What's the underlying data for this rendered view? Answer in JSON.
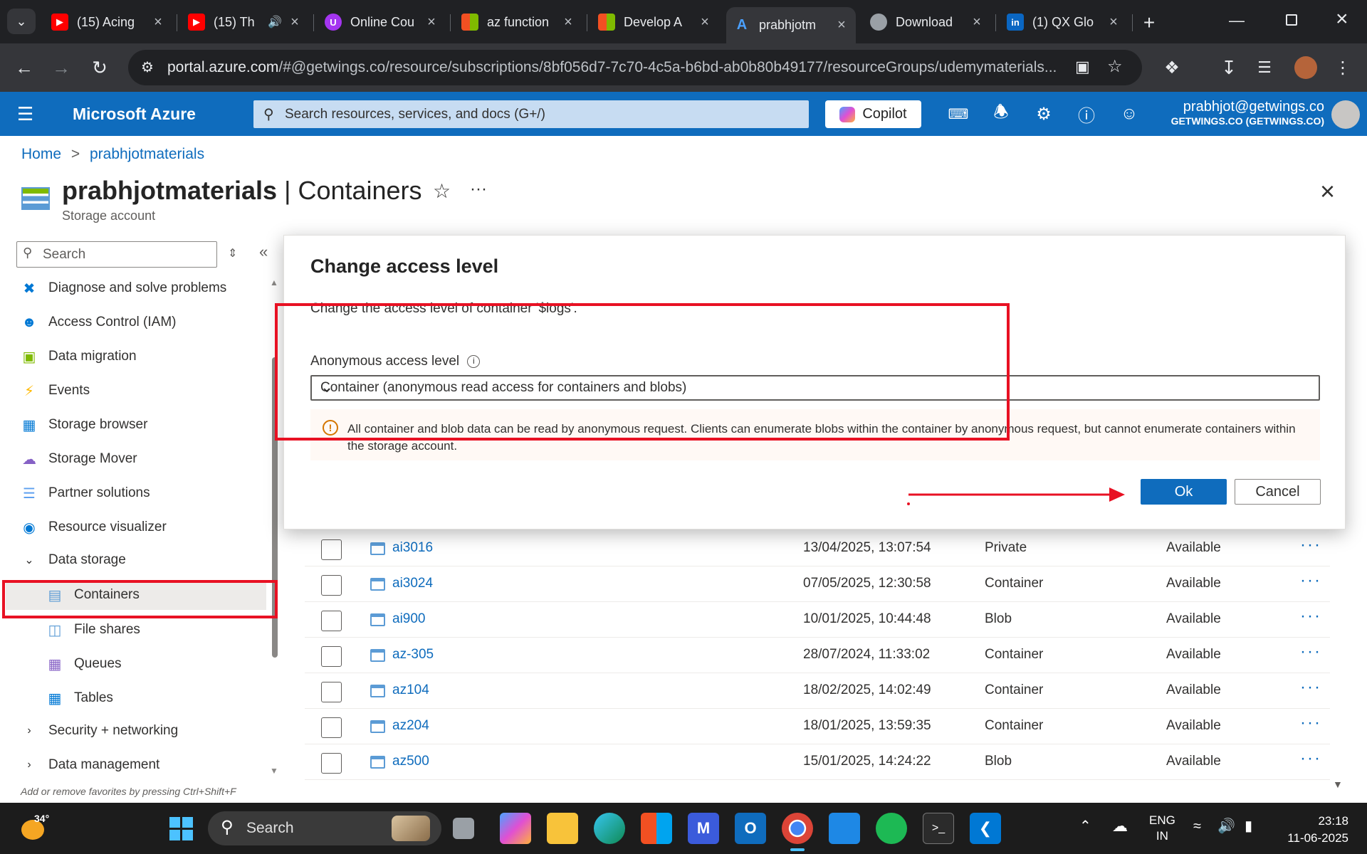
{
  "browser": {
    "tabs": [
      {
        "title": "(15) Acing",
        "favicon": "youtube-icon",
        "color": "#ff0000"
      },
      {
        "title": "(15) Th",
        "favicon": "youtube-icon",
        "color": "#ff0000"
      },
      {
        "title": "Online Cou",
        "favicon": "udemy-icon",
        "color": "#a435f0"
      },
      {
        "title": "az function",
        "favicon": "microsoft-icon",
        "color": "#f25022"
      },
      {
        "title": "Develop A",
        "favicon": "microsoft-icon",
        "color": "#f25022"
      },
      {
        "title": "prabhjotm",
        "favicon": "azure-icon",
        "color": "#0078d4"
      },
      {
        "title": "Download",
        "favicon": "globe-icon",
        "color": "#9aa0a6"
      },
      {
        "title": "(1) QX Glo",
        "favicon": "linkedin-icon",
        "color": "#0a66c2"
      }
    ],
    "url_domain": "portal.azure.com",
    "url_rest": "/#@getwings.co/resource/subscriptions/8bf056d7-7c70-4c5a-b6bd-ab0b80b49177/resourceGroups/udemymaterials..."
  },
  "azure": {
    "title": "Microsoft Azure",
    "search_placeholder": "Search resources, services, and docs (G+/)",
    "copilot": "Copilot",
    "account_email": "prabhjot@getwings.co",
    "account_tenant": "GETWINGS.CO (GETWINGS.CO)"
  },
  "breadcrumb": {
    "home": "Home",
    "sep": ">",
    "current": "prabhjotmaterials"
  },
  "page": {
    "resource": "prabhjotmaterials",
    "sep": " | ",
    "blade": "Containers",
    "subtitle": "Storage account"
  },
  "sidebar": {
    "search_placeholder": "Search",
    "items": [
      {
        "label": "Diagnose and solve problems",
        "icon": "wrench-icon"
      },
      {
        "label": "Access Control (IAM)",
        "icon": "people-icon"
      },
      {
        "label": "Data migration",
        "icon": "migration-icon"
      },
      {
        "label": "Events",
        "icon": "lightning-icon"
      },
      {
        "label": "Storage browser",
        "icon": "storage-browser-icon"
      },
      {
        "label": "Storage Mover",
        "icon": "cloud-mover-icon"
      },
      {
        "label": "Partner solutions",
        "icon": "partner-icon"
      },
      {
        "label": "Resource visualizer",
        "icon": "visualizer-icon"
      },
      {
        "label": "Data storage",
        "icon": "chevron-down-icon"
      },
      {
        "label": "Containers",
        "icon": "container-icon"
      },
      {
        "label": "File shares",
        "icon": "file-share-icon"
      },
      {
        "label": "Queues",
        "icon": "queue-icon"
      },
      {
        "label": "Tables",
        "icon": "table-icon"
      },
      {
        "label": "Security + networking",
        "icon": "chevron-right-icon"
      },
      {
        "label": "Data management",
        "icon": "chevron-right-icon"
      }
    ],
    "favorites_hint": "Add or remove favorites by pressing Ctrl+Shift+F"
  },
  "table": {
    "rows": [
      {
        "name": "ai3016",
        "modified": "13/04/2025, 13:07:54",
        "level": "Private",
        "lease": "Available"
      },
      {
        "name": "ai3024",
        "modified": "07/05/2025, 12:30:58",
        "level": "Container",
        "lease": "Available"
      },
      {
        "name": "ai900",
        "modified": "10/01/2025, 10:44:48",
        "level": "Blob",
        "lease": "Available"
      },
      {
        "name": "az-305",
        "modified": "28/07/2024, 11:33:02",
        "level": "Container",
        "lease": "Available"
      },
      {
        "name": "az104",
        "modified": "18/02/2025, 14:02:49",
        "level": "Container",
        "lease": "Available"
      },
      {
        "name": "az204",
        "modified": "18/01/2025, 13:59:35",
        "level": "Container",
        "lease": "Available"
      },
      {
        "name": "az500",
        "modified": "15/01/2025, 14:24:22",
        "level": "Blob",
        "lease": "Available"
      }
    ],
    "more": "···"
  },
  "dialog": {
    "title": "Change access level",
    "description": "Change the access level of container '$logs'.",
    "field_label": "Anonymous access level",
    "selected": "Container (anonymous read access for containers and blobs)",
    "warning": "All container and blob data can be read by anonymous request. Clients can enumerate blobs within the container by anonymous request, but cannot enumerate containers within the storage account.",
    "ok": "Ok",
    "cancel": "Cancel"
  },
  "annotation_color": "#ff0000",
  "taskbar": {
    "weather": "34°",
    "search": "Search",
    "lang1": "ENG",
    "lang2": "IN",
    "time": "23:18",
    "date": "11-06-2025"
  }
}
